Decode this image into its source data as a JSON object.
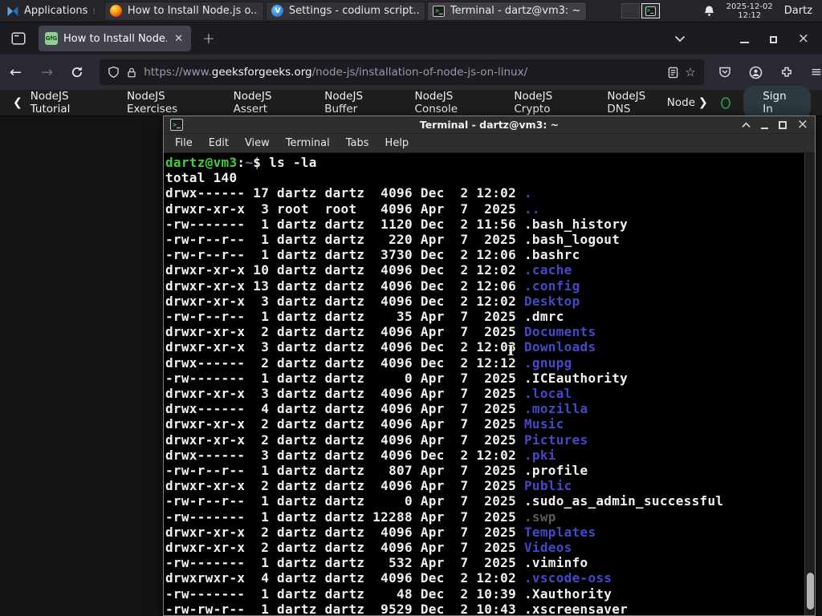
{
  "taskbar": {
    "applications_label": "Applications",
    "windows": [
      {
        "label": "How to Install Node.js o...",
        "icon": "firefox-icon"
      },
      {
        "label": "Settings - codium script...",
        "icon": "vscodium-icon"
      },
      {
        "label": "Terminal - dartz@vm3: ~",
        "icon": "terminal-icon"
      }
    ],
    "clock": {
      "date": "2025-12-02",
      "time": "12:12"
    },
    "user": "Dartz"
  },
  "browser": {
    "tab": {
      "title": "How to Install Node.js on"
    },
    "new_tab_label": "+",
    "urlbar": {
      "scheme": "https://www.",
      "domain": "geeksforgeeks.org",
      "path": "/node-js/installation-of-node-js-on-linux/"
    },
    "nav": {
      "links": [
        "NodeJS Tutorial",
        "NodeJS Exercises",
        "NodeJS Assert",
        "NodeJS Buffer",
        "NodeJS Console",
        "NodeJS Crypto",
        "NodeJS DNS",
        "Node"
      ],
      "sign_in": "Sign In"
    }
  },
  "terminal": {
    "title": "Terminal - dartz@vm3: ~",
    "menu": [
      "File",
      "Edit",
      "View",
      "Terminal",
      "Tabs",
      "Help"
    ],
    "colors": {
      "green": "#3fcf3f",
      "fg": "#f1f1f1",
      "path": "#6f74c9",
      "dir": "#4549c8",
      "dim": "#5a5a5a",
      "background": "#000000"
    },
    "prompt": [
      {
        "text": "dartz@vm3",
        "color": "green"
      },
      {
        "text": ":",
        "color": "fg"
      },
      {
        "text": "~",
        "color": "path"
      },
      {
        "text": "$ ls -la",
        "color": "fg"
      }
    ],
    "total_line": "total 140",
    "entries": [
      {
        "meta": "drwx------ 17 dartz dartz  4096 Dec  2 12:02 ",
        "name": ".",
        "type": "dir"
      },
      {
        "meta": "drwxr-xr-x  3 root  root   4096 Apr  7  2025 ",
        "name": "..",
        "type": "dir"
      },
      {
        "meta": "-rw-------  1 dartz dartz  1120 Dec  2 11:56 ",
        "name": ".bash_history",
        "type": "file"
      },
      {
        "meta": "-rw-r--r--  1 dartz dartz   220 Apr  7  2025 ",
        "name": ".bash_logout",
        "type": "file"
      },
      {
        "meta": "-rw-r--r--  1 dartz dartz  3730 Dec  2 12:06 ",
        "name": ".bashrc",
        "type": "file"
      },
      {
        "meta": "drwxr-xr-x 10 dartz dartz  4096 Dec  2 12:02 ",
        "name": ".cache",
        "type": "dir"
      },
      {
        "meta": "drwxr-xr-x 13 dartz dartz  4096 Dec  2 12:06 ",
        "name": ".config",
        "type": "dir"
      },
      {
        "meta": "drwxr-xr-x  3 dartz dartz  4096 Dec  2 12:02 ",
        "name": "Desktop",
        "type": "dir"
      },
      {
        "meta": "-rw-r--r--  1 dartz dartz    35 Apr  7  2025 ",
        "name": ".dmrc",
        "type": "file"
      },
      {
        "meta": "drwxr-xr-x  2 dartz dartz  4096 Apr  7  2025 ",
        "name": "Documents",
        "type": "dir"
      },
      {
        "meta": "drwxr-xr-x  3 dartz dartz  4096 Dec  2 12:03 ",
        "name": "Downloads",
        "type": "dir"
      },
      {
        "meta": "drwx------  2 dartz dartz  4096 Dec  2 12:12 ",
        "name": ".gnupg",
        "type": "dir"
      },
      {
        "meta": "-rw-------  1 dartz dartz     0 Apr  7  2025 ",
        "name": ".ICEauthority",
        "type": "file"
      },
      {
        "meta": "drwxr-xr-x  3 dartz dartz  4096 Apr  7  2025 ",
        "name": ".local",
        "type": "dir"
      },
      {
        "meta": "drwx------  4 dartz dartz  4096 Apr  7  2025 ",
        "name": ".mozilla",
        "type": "dir"
      },
      {
        "meta": "drwxr-xr-x  2 dartz dartz  4096 Apr  7  2025 ",
        "name": "Music",
        "type": "dir"
      },
      {
        "meta": "drwxr-xr-x  2 dartz dartz  4096 Apr  7  2025 ",
        "name": "Pictures",
        "type": "dir"
      },
      {
        "meta": "drwx------  3 dartz dartz  4096 Dec  2 12:02 ",
        "name": ".pki",
        "type": "dir"
      },
      {
        "meta": "-rw-r--r--  1 dartz dartz   807 Apr  7  2025 ",
        "name": ".profile",
        "type": "file"
      },
      {
        "meta": "drwxr-xr-x  2 dartz dartz  4096 Apr  7  2025 ",
        "name": "Public",
        "type": "dir"
      },
      {
        "meta": "-rw-r--r--  1 dartz dartz     0 Apr  7  2025 ",
        "name": ".sudo_as_admin_successful",
        "type": "file"
      },
      {
        "meta": "-rw-------  1 dartz dartz 12288 Apr  7  2025 ",
        "name": ".swp",
        "type": "dim"
      },
      {
        "meta": "drwxr-xr-x  2 dartz dartz  4096 Apr  7  2025 ",
        "name": "Templates",
        "type": "dir"
      },
      {
        "meta": "drwxr-xr-x  2 dartz dartz  4096 Apr  7  2025 ",
        "name": "Videos",
        "type": "dir"
      },
      {
        "meta": "-rw-------  1 dartz dartz   532 Apr  7  2025 ",
        "name": ".viminfo",
        "type": "file"
      },
      {
        "meta": "drwxrwxr-x  4 dartz dartz  4096 Dec  2 12:02 ",
        "name": ".vscode-oss",
        "type": "dir"
      },
      {
        "meta": "-rw-------  1 dartz dartz    48 Dec  2 10:39 ",
        "name": ".Xauthority",
        "type": "file"
      },
      {
        "meta": "-rw-rw-r--  1 dartz dartz  9529 Dec  2 10:43 ",
        "name": ".xscreensaver",
        "type": "file"
      }
    ]
  }
}
